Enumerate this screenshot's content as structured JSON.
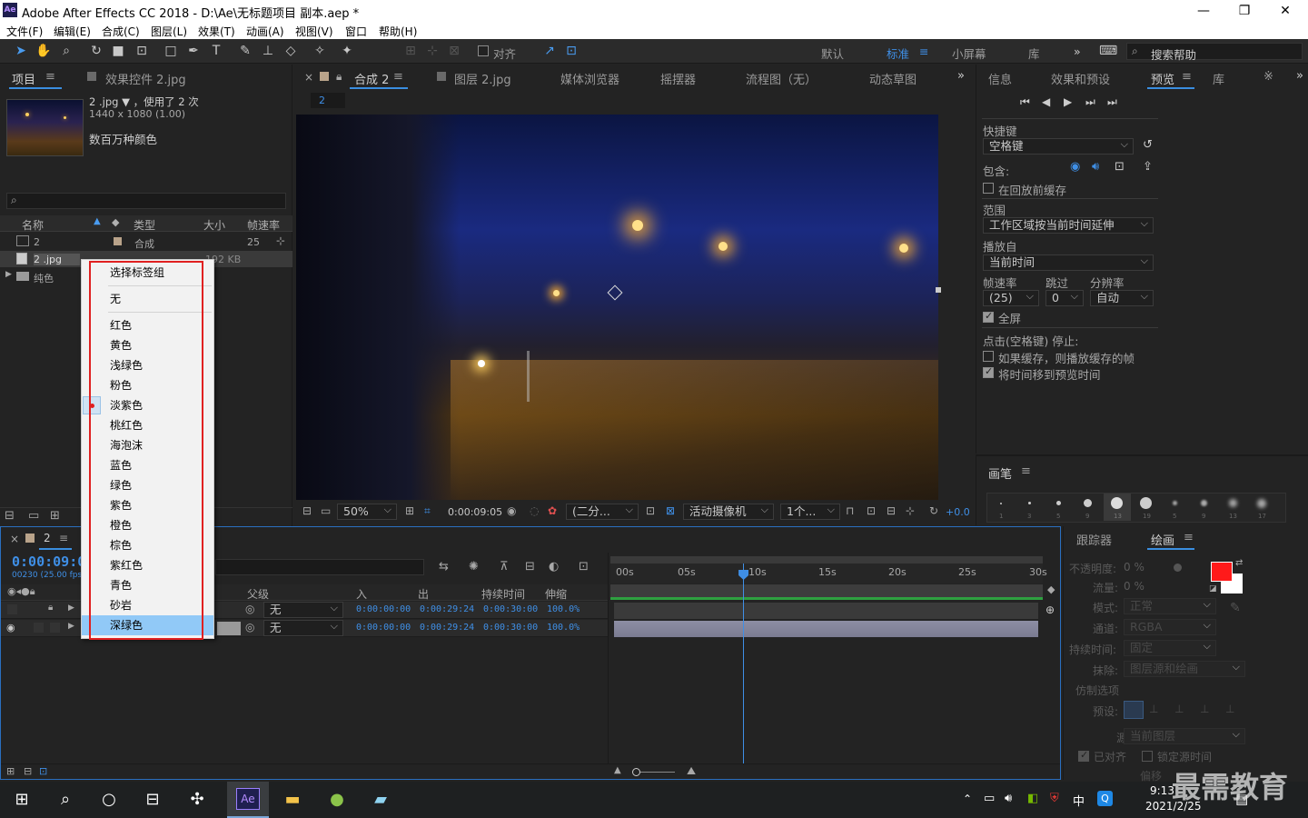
{
  "app": {
    "title": "Adobe After Effects CC 2018 - D:\\Ae\\无标题项目 副本.aep *",
    "logo": "Ae"
  },
  "window_controls": {
    "minimize": "—",
    "maximize": "❐",
    "close": "✕"
  },
  "menu": [
    "文件(F)",
    "编辑(E)",
    "合成(C)",
    "图层(L)",
    "效果(T)",
    "动画(A)",
    "视图(V)",
    "窗口",
    "帮助(H)"
  ],
  "toolbar": {
    "align_label": "对齐",
    "workspaces": [
      "默认",
      "标准",
      "小屏幕",
      "库"
    ],
    "active_workspace": "标准",
    "search_placeholder": "搜索帮助"
  },
  "project_panel": {
    "tabs": [
      "项目",
      "效果控件 2.jpg"
    ],
    "item_name": "2 .jpg",
    "usage": "，使用了 2 次",
    "dims": "1440 x 1080 (1.00)",
    "colors": "数百万种颜色",
    "columns": [
      "名称",
      "类型",
      "大小",
      "帧速率"
    ],
    "rows": [
      {
        "name": "2",
        "type": "合成",
        "size": "",
        "fps": "25"
      },
      {
        "name": "2 .jpg",
        "type": "",
        "size": "192 KB",
        "fps": ""
      },
      {
        "name": "纯色",
        "type": "",
        "size": "",
        "fps": ""
      }
    ]
  },
  "viewer": {
    "tabs": [
      "合成 2",
      "图层 2.jpg",
      "媒体浏览器",
      "摇摆器",
      "流程图（无）",
      "动态草图"
    ],
    "comp_chip": "2",
    "zoom": "50%",
    "time": "0:00:09:05",
    "resolution": "(二分...",
    "camera": "活动摄像机",
    "views": "1个...",
    "exposure": "+0.0"
  },
  "context_menu": {
    "title": "选择标签组",
    "items": [
      "无",
      "红色",
      "黄色",
      "浅绿色",
      "粉色",
      "淡紫色",
      "桃红色",
      "海泡沫",
      "蓝色",
      "绿色",
      "紫色",
      "橙色",
      "棕色",
      "紫红色",
      "青色",
      "砂岩",
      "深绿色"
    ],
    "checked": "淡紫色",
    "highlighted": "深绿色"
  },
  "preview_panel": {
    "tabs": [
      "信息",
      "效果和预设",
      "预览",
      "库"
    ],
    "active_tab": "预览",
    "shortcut_label": "快捷键",
    "shortcut_value": "空格键",
    "include_label": "包含:",
    "cache_before": "在回放前缓存",
    "range_label": "范围",
    "range_value": "工作区域按当前时间延伸",
    "play_from_label": "播放自",
    "play_from_value": "当前时间",
    "fps_label": "帧速率",
    "skip_label": "跳过",
    "res_label": "分辨率",
    "fps_value": "(25)",
    "skip_value": "0",
    "res_value": "自动",
    "fullscreen": "全屏",
    "stop_label": "点击(空格键) 停止:",
    "cache_option": "如果缓存，则播放缓存的帧",
    "move_time": "将时间移到预览时间"
  },
  "brush_panel": {
    "title": "画笔",
    "sizes": [
      "1",
      "3",
      "5",
      "9",
      "13",
      "19",
      "5",
      "9",
      "13",
      "17"
    ]
  },
  "timeline": {
    "tab": "2",
    "timecode": "0:00:09:0",
    "fps_info": "00230 (25.00 fps)",
    "columns": [
      "父级",
      "入",
      "出",
      "持续时间",
      "伸缩"
    ],
    "rows": [
      {
        "parent": "无",
        "in": "0:00:00:00",
        "out": "0:00:29:24",
        "dur": "0:00:30:00",
        "stretch": "100.0%"
      },
      {
        "parent": "无",
        "in": "0:00:00:00",
        "out": "0:00:29:24",
        "dur": "0:00:30:00",
        "stretch": "100.0%"
      }
    ],
    "ruler": [
      "00s",
      "05s",
      "10s",
      "15s",
      "20s",
      "25s",
      "30s"
    ],
    "current_pos": 0.3
  },
  "paint_panel": {
    "tabs": [
      "跟踪器",
      "绘画"
    ],
    "active_tab": "绘画",
    "opacity_label": "不透明度:",
    "opacity": "0 %",
    "flow_label": "流量:",
    "flow": "0 %",
    "mode_label": "模式:",
    "mode": "正常",
    "channel_label": "通道:",
    "channel": "RGBA",
    "duration_label": "持续时间:",
    "duration": "固定",
    "erase_label": "抹除:",
    "erase": "图层源和绘画",
    "clone_label": "仿制选项",
    "preset_label": "预设:",
    "source_label": "源:",
    "source": "当前图层",
    "aligned": "已对齐",
    "lock_time": "锁定源时间",
    "offset_label": "偏移",
    "fg_color": "#ff1a1a",
    "bg_color": "#ffffff"
  },
  "taskbar": {
    "time": "9:13",
    "date": "2021/2/25",
    "ime": "中",
    "watermark": "最需教育"
  }
}
